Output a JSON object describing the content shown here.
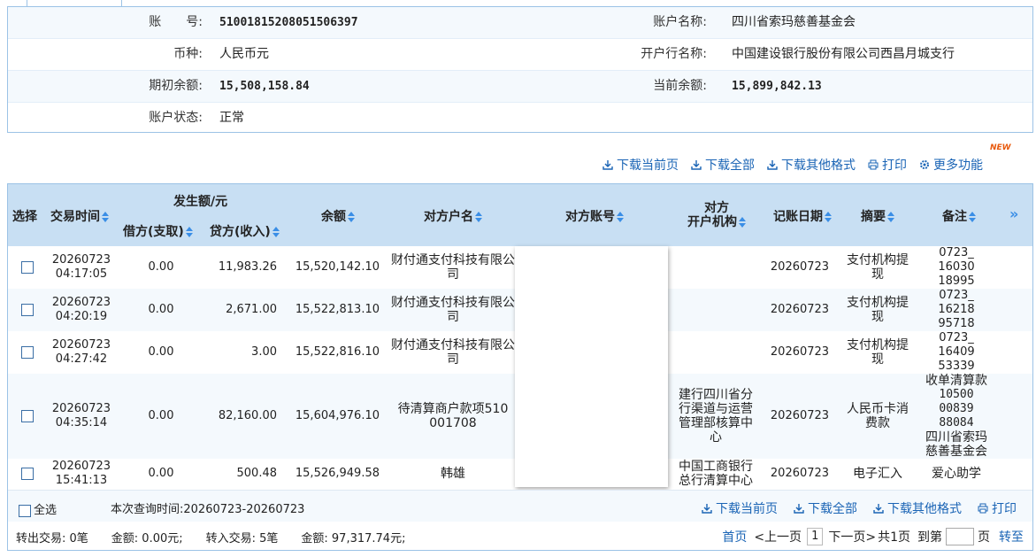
{
  "account": {
    "no_label": "账　　号:",
    "no_value": "51001815208051506397",
    "name_label": "账户名称:",
    "name_value": "四川省索玛慈善基金会",
    "currency_label": "币种:",
    "currency_value": "人民币元",
    "bank_label": "开户行名称:",
    "bank_value": "中国建设银行股份有限公司西昌月城支行",
    "opening_label": "期初余额:",
    "opening_value": "15,508,158.84",
    "current_label": "当前余额:",
    "current_value": "15,899,842.13",
    "status_label": "账户状态:",
    "status_value": "正常"
  },
  "actions": {
    "download_page": "下载当前页",
    "download_all": "下载全部",
    "download_other": "下载其他格式",
    "print": "打印",
    "more": "更多功能",
    "new_badge": "NEW"
  },
  "grid": {
    "headers": {
      "select": "选择",
      "time": "交易时间",
      "amount_group": "发生额/元",
      "debit": "借方(支取)",
      "credit": "贷方(收入)",
      "balance": "余额",
      "counter_name": "对方户名",
      "counter_account": "对方账号",
      "counter_bank_1": "对方",
      "counter_bank_2": "开户机构",
      "post_date": "记账日期",
      "summary": "摘要",
      "remark": "备注",
      "more": "»"
    },
    "rows": [
      {
        "date": "20260723",
        "time": "04:17:05",
        "debit": "0.00",
        "credit": "11,983.26",
        "balance": "15,520,142.10",
        "name_1": "财付通支付科技有限公",
        "name_2": "司",
        "bank": [],
        "post_date": "20260723",
        "summary_1": "支付机构提",
        "summary_2": "现",
        "remark": [
          "0723_",
          "16030",
          "18995"
        ]
      },
      {
        "date": "20260723",
        "time": "04:20:19",
        "debit": "0.00",
        "credit": "2,671.00",
        "balance": "15,522,813.10",
        "name_1": "财付通支付科技有限公",
        "name_2": "司",
        "bank": [],
        "post_date": "20260723",
        "summary_1": "支付机构提",
        "summary_2": "现",
        "remark": [
          "0723_",
          "16218",
          "95718"
        ]
      },
      {
        "date": "20260723",
        "time": "04:27:42",
        "debit": "0.00",
        "credit": "3.00",
        "balance": "15,522,816.10",
        "name_1": "财付通支付科技有限公",
        "name_2": "司",
        "bank": [],
        "post_date": "20260723",
        "summary_1": "支付机构提",
        "summary_2": "现",
        "remark": [
          "0723_",
          "16409",
          "53339"
        ]
      },
      {
        "date": "20260723",
        "time": "04:35:14",
        "debit": "0.00",
        "credit": "82,160.00",
        "balance": "15,604,976.10",
        "name_1": "待清算商户款项510",
        "name_2": "001708",
        "bank": [
          "建行四川省分",
          "行渠道与运营",
          "管理部核算中",
          "心"
        ],
        "post_date": "20260723",
        "summary_1": "人民币卡消",
        "summary_2": "费款",
        "remark": [
          "收单清算款",
          "10500",
          "00839",
          "88084",
          "四川省索玛",
          "慈善基金会"
        ]
      },
      {
        "date": "20260723",
        "time": "15:41:13",
        "debit": "0.00",
        "credit": "500.48",
        "balance": "15,526,949.58",
        "name_1": "韩雄",
        "name_2": "",
        "bank": [
          "中国工商银行",
          "总行清算中心"
        ],
        "post_date": "20260723",
        "summary_1": "电子汇入",
        "summary_2": "",
        "remark": [
          "爱心助学"
        ]
      }
    ]
  },
  "footer": {
    "select_all": "全选",
    "query_time": "本次查询时间:20260723-20260723",
    "download_page": "下载当前页",
    "download_all": "下载全部",
    "download_other": "下载其他格式",
    "print": "打印",
    "summary": "转出交易: 0笔　　金额: 0.00元;　　转入交易: 5笔　　金额: 97,317.74元;",
    "first": "首页",
    "prev": "<上一页",
    "page": "1",
    "next": "下一页>",
    "total": "共1页",
    "goto": "到第",
    "page_unit": "页",
    "go": "转至"
  }
}
